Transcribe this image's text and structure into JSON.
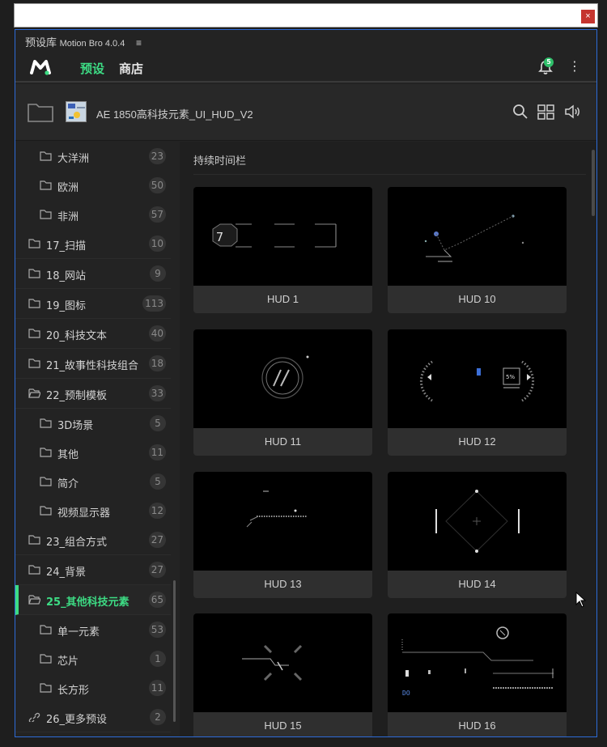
{
  "window": {
    "close_glyph": "×"
  },
  "panel": {
    "title": "预设库",
    "version": "Motion Bro 4.0.4",
    "menu_glyph": "≡"
  },
  "header": {
    "logo": "motion-bro-logo",
    "tabs": [
      {
        "label": "预设",
        "active": true
      },
      {
        "label": "商店",
        "active": false
      }
    ],
    "notification_count": "5",
    "more_glyph": "⋮"
  },
  "preset_bar": {
    "name": "AE 1850高科技元素_UI_HUD_V2",
    "tools": [
      "search-icon",
      "grid-view-icon",
      "volume-icon"
    ]
  },
  "sidebar": {
    "items": [
      {
        "label": "大洋洲",
        "count": "23",
        "level": 1,
        "icon": "folder-icon"
      },
      {
        "label": "欧洲",
        "count": "50",
        "level": 1,
        "icon": "folder-icon"
      },
      {
        "label": "非洲",
        "count": "57",
        "level": 1,
        "icon": "folder-icon"
      },
      {
        "label": "17_扫描",
        "count": "10",
        "level": 0,
        "icon": "folder-icon"
      },
      {
        "label": "18_网站",
        "count": "9",
        "level": 0,
        "icon": "folder-icon"
      },
      {
        "label": "19_图标",
        "count": "113",
        "level": 0,
        "icon": "folder-icon"
      },
      {
        "label": "20_科技文本",
        "count": "40",
        "level": 0,
        "icon": "folder-icon"
      },
      {
        "label": "21_故事性科技组合",
        "count": "18",
        "level": 0,
        "icon": "folder-icon"
      },
      {
        "label": "22_预制模板",
        "count": "33",
        "level": 0,
        "icon": "folder-open-icon"
      },
      {
        "label": "3D场景",
        "count": "5",
        "level": 1,
        "icon": "folder-icon"
      },
      {
        "label": "其他",
        "count": "11",
        "level": 1,
        "icon": "folder-icon"
      },
      {
        "label": "简介",
        "count": "5",
        "level": 1,
        "icon": "folder-icon"
      },
      {
        "label": "视频显示器",
        "count": "12",
        "level": 1,
        "icon": "folder-icon"
      },
      {
        "label": "23_组合方式",
        "count": "27",
        "level": 0,
        "icon": "folder-icon"
      },
      {
        "label": "24_背景",
        "count": "27",
        "level": 0,
        "icon": "folder-icon"
      },
      {
        "label": "25_其他科技元素",
        "count": "65",
        "level": 0,
        "icon": "folder-open-icon",
        "active": true
      },
      {
        "label": "单一元素",
        "count": "53",
        "level": 1,
        "icon": "folder-icon"
      },
      {
        "label": "芯片",
        "count": "1",
        "level": 1,
        "icon": "folder-icon"
      },
      {
        "label": "长方形",
        "count": "11",
        "level": 1,
        "icon": "folder-icon"
      },
      {
        "label": "26_更多预设",
        "count": "2",
        "level": 0,
        "icon": "link-icon"
      }
    ]
  },
  "content": {
    "section_title": "持续时间栏",
    "cards": [
      "HUD 1",
      "HUD 10",
      "HUD 11",
      "HUD 12",
      "HUD 13",
      "HUD 14",
      "HUD 15",
      "HUD 16"
    ]
  },
  "colors": {
    "accent": "#3ddc84",
    "badge": "#2fbf6a",
    "border": "#2d6bd8",
    "close": "#c5352f"
  }
}
